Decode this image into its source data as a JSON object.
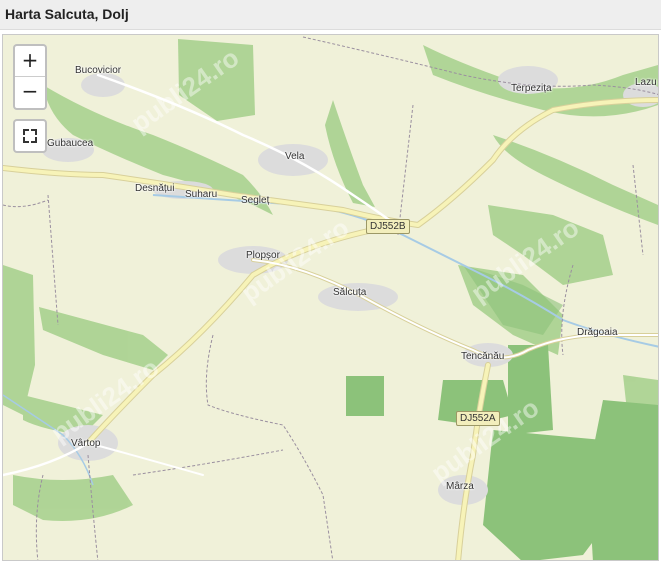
{
  "header": {
    "title": "Harta Salcuta, Dolj"
  },
  "map": {
    "controls": {
      "zoom_in": "+",
      "zoom_out": "−"
    },
    "places": {
      "bucovicior": "Bucovicior",
      "terpezita": "Terpezița",
      "lazu": "Lazu",
      "gubaucea": "Gubaucea",
      "vela": "Vela",
      "desnatui": "Desnățui",
      "suharu": "Suharu",
      "seglet": "Segleț",
      "plopsor": "Plopșor",
      "salcuta": "Sălcuța",
      "dragoaia": "Drăgoaia",
      "tencanau": "Tencănău",
      "vartop": "Vârtop",
      "marza": "Mârza"
    },
    "roads": {
      "dj552b": "DJ552B",
      "dj552a": "DJ552A"
    },
    "watermark": "publi24.ro",
    "colors": {
      "land": "#f0f1d9",
      "forest": "#a8d18f",
      "forest_dark": "#8cc27a",
      "settlement": "#dcdcdc",
      "road_major": "#f7f3b8",
      "road_casing": "#d8d09a",
      "river": "#a6cbe5",
      "boundary": "#9a8f9f"
    }
  }
}
